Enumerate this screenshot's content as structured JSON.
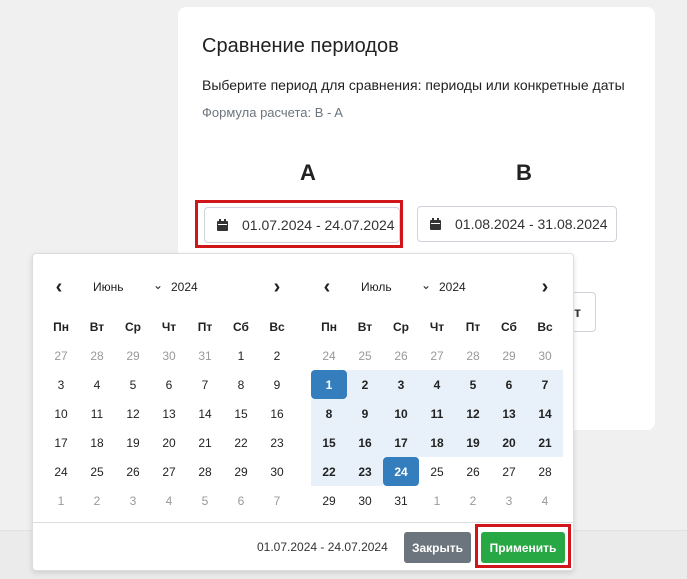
{
  "card": {
    "title": "Сравнение периодов",
    "subtitle": "Выберите период для сравнения: периоды или конкретные даты",
    "formula": "Формула расчета: B - A",
    "label_a": "A",
    "label_b": "B",
    "range_a": "01.07.2024 - 24.07.2024",
    "range_b": "01.08.2024 - 31.08.2024",
    "partial_button_text": "т"
  },
  "picker": {
    "weekdays": [
      "Пн",
      "Вт",
      "Ср",
      "Чт",
      "Пт",
      "Сб",
      "Вс"
    ],
    "left": {
      "month": "Июнь",
      "year": "2024",
      "weeks": [
        [
          [
            "27",
            0
          ],
          [
            "28",
            0
          ],
          [
            "29",
            0
          ],
          [
            "30",
            0
          ],
          [
            "31",
            0
          ],
          [
            "1",
            1
          ],
          [
            "2",
            1
          ]
        ],
        [
          [
            "3",
            1
          ],
          [
            "4",
            1
          ],
          [
            "5",
            1
          ],
          [
            "6",
            1
          ],
          [
            "7",
            1
          ],
          [
            "8",
            1
          ],
          [
            "9",
            1
          ]
        ],
        [
          [
            "10",
            1
          ],
          [
            "11",
            1
          ],
          [
            "12",
            1
          ],
          [
            "13",
            1
          ],
          [
            "14",
            1
          ],
          [
            "15",
            1
          ],
          [
            "16",
            1
          ]
        ],
        [
          [
            "17",
            1
          ],
          [
            "18",
            1
          ],
          [
            "19",
            1
          ],
          [
            "20",
            1
          ],
          [
            "21",
            1
          ],
          [
            "22",
            1
          ],
          [
            "23",
            1
          ]
        ],
        [
          [
            "24",
            1
          ],
          [
            "25",
            1
          ],
          [
            "26",
            1
          ],
          [
            "27",
            1
          ],
          [
            "28",
            1
          ],
          [
            "29",
            1
          ],
          [
            "30",
            1
          ]
        ],
        [
          [
            "1",
            0
          ],
          [
            "2",
            0
          ],
          [
            "3",
            0
          ],
          [
            "4",
            0
          ],
          [
            "5",
            0
          ],
          [
            "6",
            0
          ],
          [
            "7",
            0
          ]
        ]
      ]
    },
    "right": {
      "month": "Июль",
      "year": "2024",
      "weeks": [
        [
          [
            "24",
            0
          ],
          [
            "25",
            0
          ],
          [
            "26",
            0
          ],
          [
            "27",
            0
          ],
          [
            "28",
            0
          ],
          [
            "29",
            0
          ],
          [
            "30",
            0
          ]
        ],
        [
          [
            "1",
            3
          ],
          [
            "2",
            2
          ],
          [
            "3",
            2
          ],
          [
            "4",
            2
          ],
          [
            "5",
            2
          ],
          [
            "6",
            2
          ],
          [
            "7",
            2
          ]
        ],
        [
          [
            "8",
            2
          ],
          [
            "9",
            2
          ],
          [
            "10",
            2
          ],
          [
            "11",
            2
          ],
          [
            "12",
            2
          ],
          [
            "13",
            2
          ],
          [
            "14",
            2
          ]
        ],
        [
          [
            "15",
            2
          ],
          [
            "16",
            2
          ],
          [
            "17",
            2
          ],
          [
            "18",
            2
          ],
          [
            "19",
            2
          ],
          [
            "20",
            2
          ],
          [
            "21",
            2
          ]
        ],
        [
          [
            "22",
            2
          ],
          [
            "23",
            2
          ],
          [
            "24",
            3
          ],
          [
            "25",
            1
          ],
          [
            "26",
            1
          ],
          [
            "27",
            1
          ],
          [
            "28",
            1
          ]
        ],
        [
          [
            "29",
            1
          ],
          [
            "30",
            1
          ],
          [
            "31",
            1
          ],
          [
            "1",
            0
          ],
          [
            "2",
            0
          ],
          [
            "3",
            0
          ],
          [
            "4",
            0
          ]
        ]
      ]
    },
    "selected_range": "01.07.2024 - 24.07.2024",
    "close_label": "Закрыть",
    "apply_label": "Применить"
  },
  "colors": {
    "highlight_border": "#d0161b",
    "endpoint": "#357ebd",
    "in_range": "#e8f1f9",
    "apply": "#28a745",
    "close": "#6c757d"
  }
}
